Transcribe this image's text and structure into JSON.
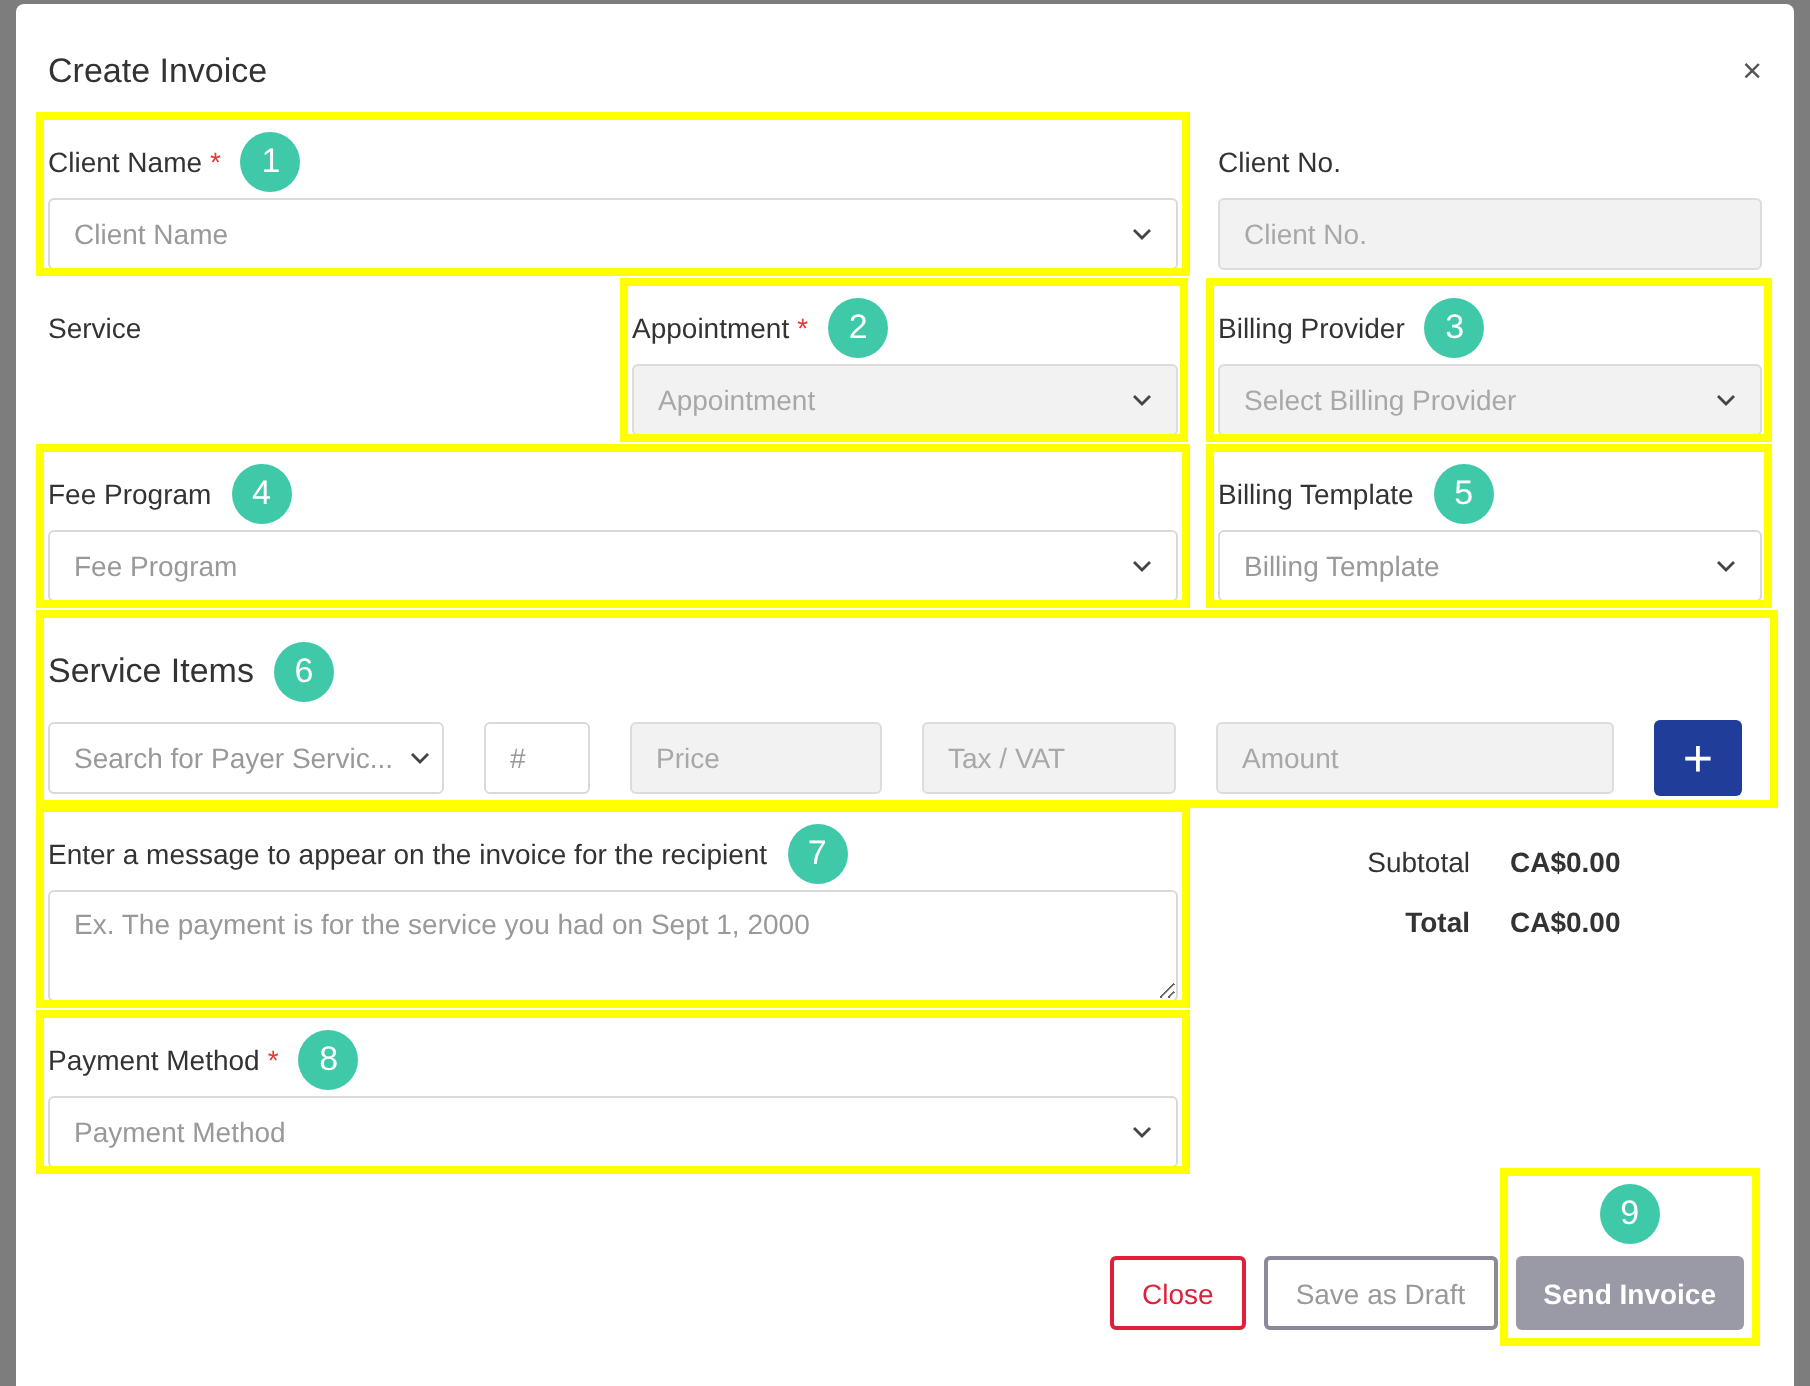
{
  "dialog": {
    "title": "Create Invoice",
    "close": "×"
  },
  "client_name": {
    "label": "Client Name",
    "required_mark": "*",
    "kind": "select",
    "placeholder": "Client Name",
    "disabled": false,
    "annotation": "1"
  },
  "client_no": {
    "label": "Client No.",
    "kind": "input",
    "placeholder": "Client No.",
    "disabled": true
  },
  "service": {
    "label": "Service"
  },
  "appointment": {
    "label": "Appointment",
    "required_mark": "*",
    "kind": "select",
    "placeholder": "Appointment",
    "disabled": true,
    "annotation": "2"
  },
  "billing_provider": {
    "label": "Billing Provider",
    "kind": "select",
    "placeholder": "Select Billing Provider",
    "disabled": true,
    "annotation": "3"
  },
  "fee_program": {
    "label": "Fee Program",
    "kind": "select",
    "placeholder": "Fee Program",
    "disabled": false,
    "annotation": "4"
  },
  "billing_template": {
    "label": "Billing Template",
    "kind": "select",
    "placeholder": "Billing Template",
    "disabled": false,
    "annotation": "5"
  },
  "service_items": {
    "title": "Service Items",
    "annotation": "6",
    "add_button": "+",
    "fields": [
      {
        "kind": "select",
        "placeholder": "Search for Payer Servic...",
        "disabled": false
      },
      {
        "kind": "input",
        "placeholder": "#",
        "disabled": false
      },
      {
        "kind": "input",
        "placeholder": "Price",
        "disabled": true
      },
      {
        "kind": "input",
        "placeholder": "Tax / VAT",
        "disabled": true
      },
      {
        "kind": "input",
        "placeholder": "Amount",
        "disabled": true
      }
    ]
  },
  "message": {
    "label": "Enter a message to appear on the invoice for the recipient",
    "kind": "textarea",
    "placeholder": "Ex. The payment is for the service you had on Sept 1, 2000",
    "disabled": false,
    "annotation": "7"
  },
  "totals": [
    {
      "label": "Subtotal",
      "value": "CA$0.00",
      "emphasis": false
    },
    {
      "label": "Total",
      "value": "CA$0.00",
      "emphasis": true
    }
  ],
  "payment_method": {
    "label": "Payment Method",
    "required_mark": "*",
    "kind": "select",
    "placeholder": "Payment Method",
    "disabled": false,
    "annotation": "8"
  },
  "buttons": [
    {
      "label": "Close",
      "kind": "danger",
      "disabled": false
    },
    {
      "label": "Save as Draft",
      "kind": "outline",
      "disabled": false
    },
    {
      "label": "Send Invoice",
      "kind": "primary",
      "disabled": true,
      "annotation": "9"
    }
  ]
}
